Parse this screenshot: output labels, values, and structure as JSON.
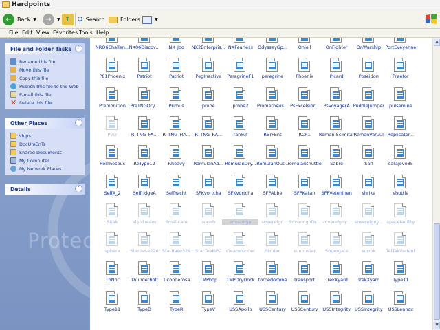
{
  "window": {
    "title": "Hardpoints"
  },
  "toolbar": {
    "back_label": "Back",
    "search_label": "Search",
    "folders_label": "Folders"
  },
  "menu": [
    "File",
    "Edit",
    "View",
    "Favorites",
    "Tools",
    "Help"
  ],
  "tasks": {
    "header": "File and Folder Tasks",
    "items": [
      "Rename this file",
      "Move this file",
      "Copy this file",
      "Publish this file to the Web",
      "E-mail this file",
      "Delete this file"
    ]
  },
  "places": {
    "header": "Other Places",
    "items": [
      "ships",
      "DocUmEnTs",
      "Shared Documents",
      "My Computer",
      "My Network Places"
    ]
  },
  "details": {
    "header": "Details"
  },
  "watermark": "Protec",
  "files": [
    {
      "label": "NRO6Challen...",
      "ghost": false
    },
    {
      "label": "NX06Discov...",
      "ghost": false
    },
    {
      "label": "NX_Joo",
      "ghost": false
    },
    {
      "label": "NX2Enterpris...",
      "ghost": false
    },
    {
      "label": "NXFearless",
      "ghost": false
    },
    {
      "label": "OdysseyGp...",
      "ghost": false
    },
    {
      "label": "Oniell",
      "ghost": false
    },
    {
      "label": "OnFighter",
      "ghost": false
    },
    {
      "label": "OnWarship",
      "ghost": false
    },
    {
      "label": "PortEveyenne",
      "ghost": false
    },
    {
      "label": "P81Phoenix",
      "ghost": false
    },
    {
      "label": "Patriot",
      "ghost": false
    },
    {
      "label": "Patriot",
      "ghost": false
    },
    {
      "label": "PegInactive",
      "ghost": false
    },
    {
      "label": "PeragrineF1",
      "ghost": false
    },
    {
      "label": "peregrine",
      "ghost": false
    },
    {
      "label": "Phoenix",
      "ghost": false
    },
    {
      "label": "Picard",
      "ghost": false
    },
    {
      "label": "Poseidon",
      "ghost": false
    },
    {
      "label": "Praetor",
      "ghost": false
    },
    {
      "label": "Premonition",
      "ghost": false
    },
    {
      "label": "PreTNGDry...",
      "ghost": false
    },
    {
      "label": "Primus",
      "ghost": false
    },
    {
      "label": "probe",
      "ghost": false
    },
    {
      "label": "probe2",
      "ghost": false
    },
    {
      "label": "Prometheus...",
      "ghost": false
    },
    {
      "label": "PsExcelsior...",
      "ghost": false
    },
    {
      "label": "PsVoyagerA",
      "ghost": false
    },
    {
      "label": "PuddleJumper",
      "ghost": false
    },
    {
      "label": "pulsemine",
      "ghost": false
    },
    {
      "label": "Pvcr",
      "ghost": true
    },
    {
      "label": "R_TNG_FA...",
      "ghost": false
    },
    {
      "label": "R_TNG_HA...",
      "ghost": false
    },
    {
      "label": "R_TNG_RA...",
      "ghost": false
    },
    {
      "label": "rankuf",
      "ghost": false
    },
    {
      "label": "RBrFEnt",
      "ghost": false
    },
    {
      "label": "RCR1",
      "ghost": false
    },
    {
      "label": "Roman Scimitar",
      "ghost": false
    },
    {
      "label": "RemanVaruul",
      "ghost": false
    },
    {
      "label": "Replicator...",
      "ghost": false
    },
    {
      "label": "RelTheseus",
      "ghost": false
    },
    {
      "label": "ReType12",
      "ghost": false
    },
    {
      "label": "Rheavy",
      "ghost": false
    },
    {
      "label": "RomulanAd...",
      "ghost": false
    },
    {
      "label": "RomulanDry...",
      "ghost": false
    },
    {
      "label": "RomulanOut...",
      "ghost": false
    },
    {
      "label": "romulanshuttle",
      "ghost": false
    },
    {
      "label": "Sabre",
      "ghost": false
    },
    {
      "label": "Salf",
      "ghost": false
    },
    {
      "label": "sarajevo85",
      "ghost": false
    },
    {
      "label": "SelfA_2",
      "ghost": false
    },
    {
      "label": "SelfridgeA",
      "ghost": false
    },
    {
      "label": "SelfYacht",
      "ghost": false
    },
    {
      "label": "SFKvortcha",
      "ghost": false
    },
    {
      "label": "SFKvortcha",
      "ghost": false
    },
    {
      "label": "SFPAbbe",
      "ghost": false
    },
    {
      "label": "SFPKatan",
      "ghost": false
    },
    {
      "label": "SFPVetehinen",
      "ghost": false
    },
    {
      "label": "shrike",
      "ghost": false
    },
    {
      "label": "shuttle",
      "ghost": false
    },
    {
      "label": "Sitak",
      "ghost": true
    },
    {
      "label": "slipstream",
      "ghost": true
    },
    {
      "label": "Smallcare",
      "ghost": true
    },
    {
      "label": "sonab",
      "ghost": true
    },
    {
      "label": "sovereign",
      "ghost": true,
      "selected": true
    },
    {
      "label": "sovereign",
      "ghost": true
    },
    {
      "label": "SovereignDr...",
      "ghost": true
    },
    {
      "label": "sovereigny...",
      "ghost": true
    },
    {
      "label": "sovereigny...",
      "ghost": true
    },
    {
      "label": "spacefacility",
      "ghost": true
    },
    {
      "label": "sphere",
      "ghost": true
    },
    {
      "label": "Starbase220",
      "ghost": true
    },
    {
      "label": "StarBase329",
      "ghost": true
    },
    {
      "label": "StarTeeMPC",
      "ghost": true
    },
    {
      "label": "steamrunner",
      "ghost": true
    },
    {
      "label": "Strider",
      "ghost": true
    },
    {
      "label": "sunbuster",
      "ghost": true
    },
    {
      "label": "Supergate",
      "ghost": true
    },
    {
      "label": "surrok",
      "ghost": true
    },
    {
      "label": "TelTakVariant",
      "ghost": true
    },
    {
      "label": "ThNor",
      "ghost": false
    },
    {
      "label": "Thunderbolt",
      "ghost": false
    },
    {
      "label": "Ticonderosa",
      "ghost": false
    },
    {
      "label": "TMPbop",
      "ghost": false
    },
    {
      "label": "TMPDryDock",
      "ghost": false
    },
    {
      "label": "torpedomine",
      "ghost": false
    },
    {
      "label": "transport",
      "ghost": false
    },
    {
      "label": "TrekXyard",
      "ghost": false
    },
    {
      "label": "TrekXyard",
      "ghost": false
    },
    {
      "label": "Type11",
      "ghost": false
    },
    {
      "label": "Type11",
      "ghost": false
    },
    {
      "label": "TypeD",
      "ghost": false
    },
    {
      "label": "TypeR",
      "ghost": false
    },
    {
      "label": "TypeV",
      "ghost": false
    },
    {
      "label": "USSApollo",
      "ghost": false
    },
    {
      "label": "USSCentury",
      "ghost": false
    },
    {
      "label": "USSCentury",
      "ghost": false
    },
    {
      "label": "USSIntegrity",
      "ghost": false
    },
    {
      "label": "USSIntegrity",
      "ghost": false
    },
    {
      "label": "USSLennox",
      "ghost": false
    }
  ]
}
